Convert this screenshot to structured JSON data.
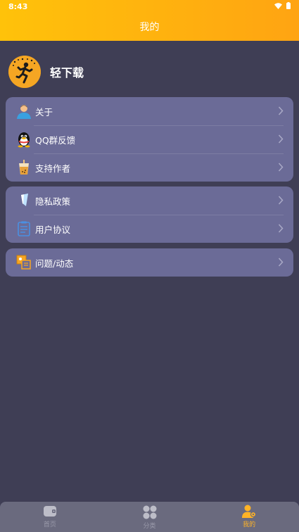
{
  "status": {
    "time": "8:43"
  },
  "header": {
    "title": "我的"
  },
  "profile": {
    "app_name": "轻下载"
  },
  "groups": [
    {
      "items": [
        {
          "label": "关于",
          "icon": "person-icon"
        },
        {
          "label": "QQ群反馈",
          "icon": "qq-penguin-icon"
        },
        {
          "label": "支持作者",
          "icon": "drink-cup-icon"
        }
      ]
    },
    {
      "items": [
        {
          "label": "隐私政策",
          "icon": "shield-icon"
        },
        {
          "label": "用户协议",
          "icon": "document-icon"
        }
      ]
    },
    {
      "items": [
        {
          "label": "问题/动态",
          "icon": "feedback-icon"
        }
      ]
    }
  ],
  "tabbar": {
    "tabs": [
      {
        "label": "首页",
        "icon": "home-icon"
      },
      {
        "label": "分类",
        "icon": "category-icon"
      },
      {
        "label": "我的",
        "icon": "profile-icon"
      }
    ],
    "active_index": 2
  },
  "colors": {
    "accent": "#ffb020",
    "background": "#3f3e55",
    "card": "#6b6b97",
    "tabbar": "#6a6a7e"
  }
}
